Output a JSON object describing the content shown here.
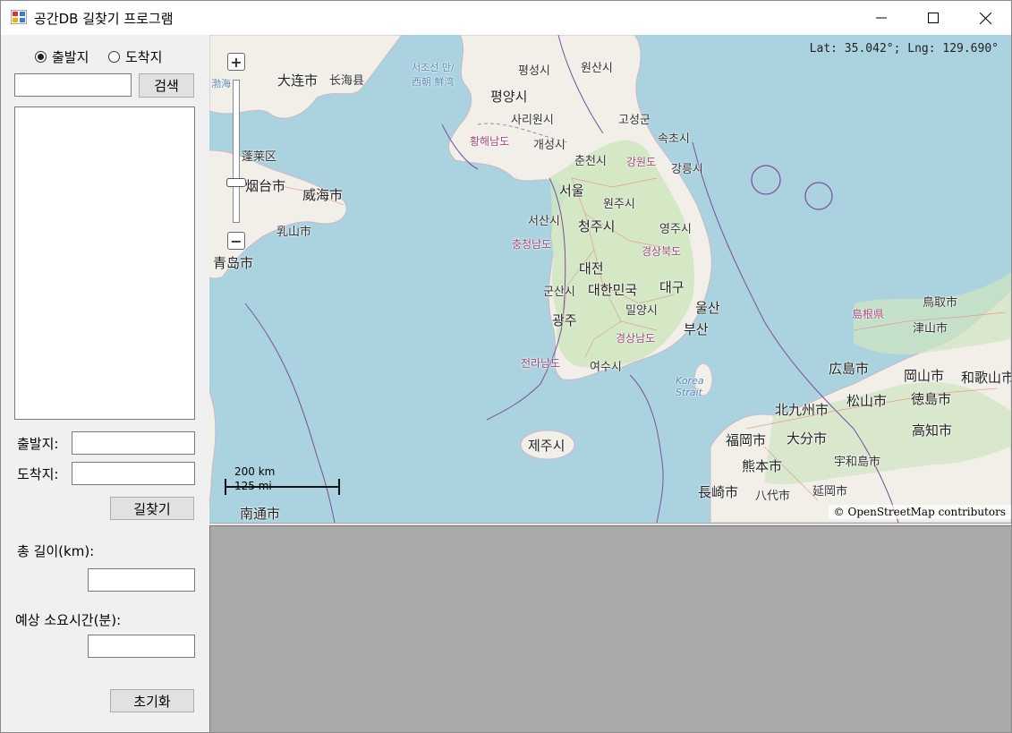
{
  "window": {
    "title": "공간DB 길찾기 프로그램"
  },
  "search": {
    "radio_start": "출발지",
    "radio_end": "도착지",
    "selected": "start",
    "query": "",
    "button": "검색"
  },
  "route": {
    "start_label": "출발지:",
    "end_label": "도착지:",
    "start_value": "",
    "end_value": "",
    "button": "길찾기"
  },
  "result": {
    "length_label": "총 길이(km):",
    "length_value": "",
    "time_label": "예상 소요시간(분):",
    "time_value": "",
    "reset_button": "초기화"
  },
  "map": {
    "coords": "Lat: 35.042°; Lng: 129.690°",
    "attribution": "© OpenStreetMap contributors",
    "scale_km": "200 km",
    "scale_mi": "125 mi",
    "labels": {
      "seoul": "서울",
      "pyongyang": "평양시",
      "daejeon": "대전",
      "gwangju": "광주",
      "daegu": "대구",
      "busan": "부산",
      "ulsan": "울산",
      "jeju": "제주시",
      "cheongju": "청주시",
      "korea": "대한민국",
      "suwon": "원주시",
      "gangneung": "강릉시",
      "sokcho": "속초시",
      "yeosu": "여수시",
      "gunsan": "군산시",
      "seosan": "서산시",
      "dalian": "大连市",
      "changhai": "长海县",
      "weihai": "威海市",
      "yantai": "烟台市",
      "qingdao": "青岛市",
      "penglai": "蓬莱区",
      "rushan": "乳山市",
      "nantong": "南通市",
      "fukuoka": "福岡市",
      "kitakyushu": "北九州市",
      "kumamoto": "熊本市",
      "nagasaki": "長崎市",
      "oita": "大分市",
      "hiroshima": "広島市",
      "okayama": "岡山市",
      "matsuyama": "松山市",
      "tokushima": "徳島市",
      "kochi": "高知市",
      "wakayama": "和歌山市",
      "tsuyama": "津山市",
      "shimane": "島根県",
      "tottori": "鳥取市",
      "uwajima": "宇和島市",
      "nobeoka": "延岡市",
      "yatsushiro": "八代市",
      "korea_strait": "Korea Strait",
      "chungnam": "충청남도",
      "jeonnam": "전라남도",
      "gyeongbuk": "경상북도",
      "gyeongnam": "경상남도",
      "gangwon": "강원도",
      "hwanghae": "황해남도",
      "kaesong": "개성시",
      "chuncheon": "춘천시",
      "yeongju": "영주시",
      "miryang": "밀양시",
      "wonsan": "원산시",
      "pyeongseong": "평성시",
      "sariwon": "사리원시",
      "goseong": "고성군",
      "bohai": "渤海",
      "seochosea": "서조선 만/西朝 鮮湾"
    }
  }
}
